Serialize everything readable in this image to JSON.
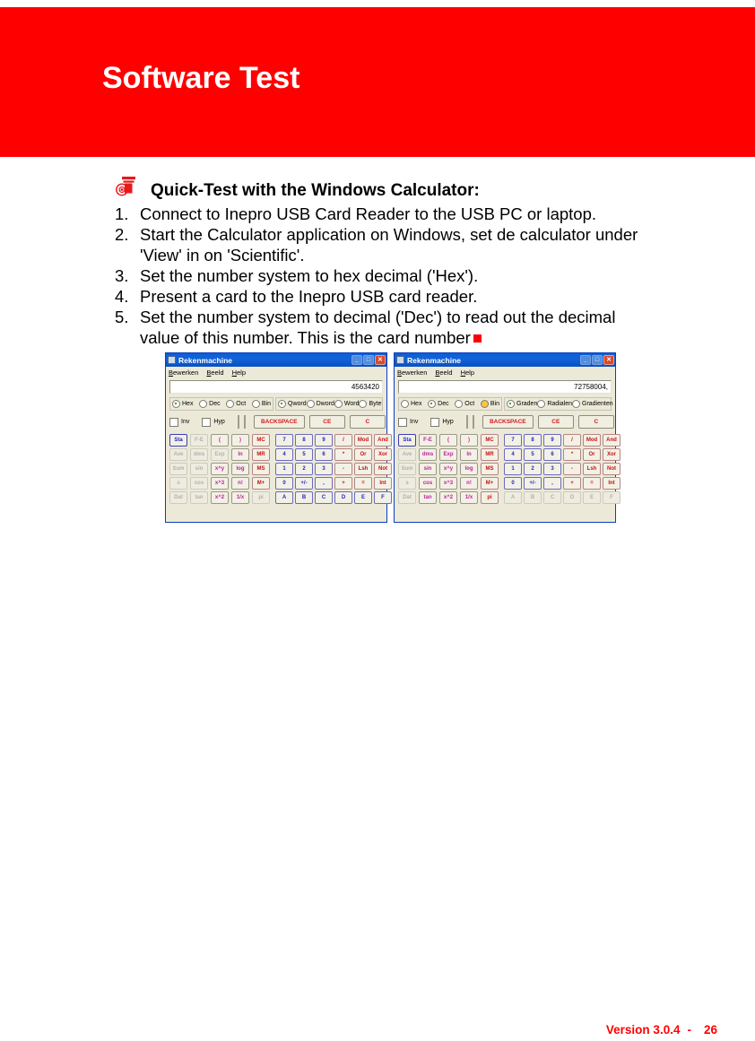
{
  "header": {
    "title": "Software Test",
    "band_color": "#fe0000"
  },
  "instructions": {
    "icon": "card-reader-icon",
    "heading": "Quick-Test with the Windows Calculator:",
    "steps": [
      {
        "num": "1.",
        "text": "Connect to Inepro USB Card Reader to the USB PC or laptop."
      },
      {
        "num": "2.",
        "text": "Start the Calculator application on Windows, set de calculator under 'View' in on 'Scientific'."
      },
      {
        "num": "3.",
        "text": "Set the number system to hex decimal ('Hex')."
      },
      {
        "num": "4.",
        "text": "Present a card to the Inepro USB card reader."
      },
      {
        "num": "5.",
        "text": "Set the number system to decimal ('Dec') to read out the decimal value of this number. This is the card number"
      }
    ],
    "end_marker_color": "#fe0000"
  },
  "calculators": [
    {
      "id": "calc-one",
      "title": "Rekenmachine",
      "menus": [
        "Bewerken",
        "Beeld",
        "Help"
      ],
      "display": "4563420",
      "base_radios": [
        {
          "label": "Hex",
          "selected": true,
          "focus": false
        },
        {
          "label": "Dec",
          "selected": false,
          "focus": false
        },
        {
          "label": "Oct",
          "selected": false,
          "focus": false
        },
        {
          "label": "Bin",
          "selected": false,
          "focus": false
        }
      ],
      "mode_radios": [
        {
          "label": "Qword",
          "selected": true,
          "focus": false
        },
        {
          "label": "Dword",
          "selected": false,
          "focus": false
        },
        {
          "label": "Word",
          "selected": false,
          "focus": false
        },
        {
          "label": "Byte",
          "selected": false,
          "focus": false
        }
      ],
      "checks": [
        {
          "label": "Inv",
          "checked": false
        },
        {
          "label": "Hyp",
          "checked": false
        }
      ],
      "command_buttons": [
        "BACKSPACE",
        "CE",
        "C"
      ],
      "keypad": {
        "col_sta": [
          {
            "label": "Sta",
            "style": "strong"
          },
          {
            "label": "Ave",
            "style": "dim"
          },
          {
            "label": "Sum",
            "style": "dim"
          },
          {
            "label": "s",
            "style": "dim"
          },
          {
            "label": "Dat",
            "style": "dim"
          }
        ],
        "col_fn1": [
          {
            "label": "F-E",
            "style": "dim"
          },
          {
            "label": "dms",
            "style": "dim"
          },
          {
            "label": "sin",
            "style": "dim"
          },
          {
            "label": "cos",
            "style": "dim"
          },
          {
            "label": "tan",
            "style": "dim"
          }
        ],
        "col_fn2": [
          {
            "label": "(",
            "style": "pink"
          },
          {
            "label": "Exp",
            "style": "dim"
          },
          {
            "label": "x^y",
            "style": "pink"
          },
          {
            "label": "x^3",
            "style": "pink"
          },
          {
            "label": "x^2",
            "style": "pink"
          }
        ],
        "col_fn3": [
          {
            "label": ")",
            "style": "pink"
          },
          {
            "label": "ln",
            "style": "pink"
          },
          {
            "label": "log",
            "style": "pink"
          },
          {
            "label": "n!",
            "style": "pink"
          },
          {
            "label": "1/x",
            "style": "pink"
          }
        ],
        "col_mem": [
          {
            "label": "MC",
            "style": "red"
          },
          {
            "label": "MR",
            "style": "red"
          },
          {
            "label": "MS",
            "style": "red"
          },
          {
            "label": "M+",
            "style": "red"
          },
          {
            "label": "pi",
            "style": "dim"
          }
        ],
        "grid": [
          [
            {
              "label": "7",
              "style": "blue"
            },
            {
              "label": "8",
              "style": "blue"
            },
            {
              "label": "9",
              "style": "blue"
            },
            {
              "label": "/",
              "style": "red"
            },
            {
              "label": "Mod",
              "style": "red"
            },
            {
              "label": "And",
              "style": "red"
            }
          ],
          [
            {
              "label": "4",
              "style": "blue"
            },
            {
              "label": "5",
              "style": "blue"
            },
            {
              "label": "6",
              "style": "blue"
            },
            {
              "label": "*",
              "style": "red"
            },
            {
              "label": "Or",
              "style": "red"
            },
            {
              "label": "Xor",
              "style": "red"
            }
          ],
          [
            {
              "label": "1",
              "style": "blue"
            },
            {
              "label": "2",
              "style": "blue"
            },
            {
              "label": "3",
              "style": "blue"
            },
            {
              "label": "-",
              "style": "red"
            },
            {
              "label": "Lsh",
              "style": "red"
            },
            {
              "label": "Not",
              "style": "red"
            }
          ],
          [
            {
              "label": "0",
              "style": "blue"
            },
            {
              "label": "+/-",
              "style": "blue"
            },
            {
              "label": ",",
              "style": "blue"
            },
            {
              "label": "+",
              "style": "red"
            },
            {
              "label": "=",
              "style": "red"
            },
            {
              "label": "Int",
              "style": "red"
            }
          ],
          [
            {
              "label": "A",
              "style": "blue"
            },
            {
              "label": "B",
              "style": "blue"
            },
            {
              "label": "C",
              "style": "blue"
            },
            {
              "label": "D",
              "style": "blue"
            },
            {
              "label": "E",
              "style": "blue"
            },
            {
              "label": "F",
              "style": "blue"
            }
          ]
        ]
      }
    },
    {
      "id": "calc-two",
      "title": "Rekenmachine",
      "menus": [
        "Bewerken",
        "Beeld",
        "Help"
      ],
      "display": "72758004,",
      "base_radios": [
        {
          "label": "Hex",
          "selected": false,
          "focus": false
        },
        {
          "label": "Dec",
          "selected": true,
          "focus": false
        },
        {
          "label": "Oct",
          "selected": false,
          "focus": false
        },
        {
          "label": "Bin",
          "selected": false,
          "focus": true
        }
      ],
      "mode_radios": [
        {
          "label": "Graden",
          "selected": true,
          "focus": false
        },
        {
          "label": "Radialen",
          "selected": false,
          "focus": false
        },
        {
          "label": "Gradienten",
          "selected": false,
          "focus": false
        }
      ],
      "checks": [
        {
          "label": "Inv",
          "checked": false
        },
        {
          "label": "Hyp",
          "checked": false
        }
      ],
      "command_buttons": [
        "BACKSPACE",
        "CE",
        "C"
      ],
      "keypad": {
        "col_sta": [
          {
            "label": "Sta",
            "style": "strong"
          },
          {
            "label": "Ave",
            "style": "dim"
          },
          {
            "label": "Sum",
            "style": "dim"
          },
          {
            "label": "s",
            "style": "dim"
          },
          {
            "label": "Dat",
            "style": "dim"
          }
        ],
        "col_fn1": [
          {
            "label": "F-E",
            "style": "pink"
          },
          {
            "label": "dms",
            "style": "pink"
          },
          {
            "label": "sin",
            "style": "pink"
          },
          {
            "label": "cos",
            "style": "pink"
          },
          {
            "label": "tan",
            "style": "pink"
          }
        ],
        "col_fn2": [
          {
            "label": "(",
            "style": "pink"
          },
          {
            "label": "Exp",
            "style": "pink"
          },
          {
            "label": "x^y",
            "style": "pink"
          },
          {
            "label": "x^3",
            "style": "pink"
          },
          {
            "label": "x^2",
            "style": "pink"
          }
        ],
        "col_fn3": [
          {
            "label": ")",
            "style": "pink"
          },
          {
            "label": "ln",
            "style": "pink"
          },
          {
            "label": "log",
            "style": "pink"
          },
          {
            "label": "n!",
            "style": "pink"
          },
          {
            "label": "1/x",
            "style": "pink"
          }
        ],
        "col_mem": [
          {
            "label": "MC",
            "style": "red"
          },
          {
            "label": "MR",
            "style": "red"
          },
          {
            "label": "MS",
            "style": "red"
          },
          {
            "label": "M+",
            "style": "red"
          },
          {
            "label": "pi",
            "style": "red"
          }
        ],
        "grid": [
          [
            {
              "label": "7",
              "style": "blue"
            },
            {
              "label": "8",
              "style": "blue"
            },
            {
              "label": "9",
              "style": "blue"
            },
            {
              "label": "/",
              "style": "red"
            },
            {
              "label": "Mod",
              "style": "red"
            },
            {
              "label": "And",
              "style": "red"
            }
          ],
          [
            {
              "label": "4",
              "style": "blue"
            },
            {
              "label": "5",
              "style": "blue"
            },
            {
              "label": "6",
              "style": "blue"
            },
            {
              "label": "*",
              "style": "red"
            },
            {
              "label": "Or",
              "style": "red"
            },
            {
              "label": "Xor",
              "style": "red"
            }
          ],
          [
            {
              "label": "1",
              "style": "blue"
            },
            {
              "label": "2",
              "style": "blue"
            },
            {
              "label": "3",
              "style": "blue"
            },
            {
              "label": "-",
              "style": "red"
            },
            {
              "label": "Lsh",
              "style": "red"
            },
            {
              "label": "Not",
              "style": "red"
            }
          ],
          [
            {
              "label": "0",
              "style": "blue"
            },
            {
              "label": "+/-",
              "style": "blue"
            },
            {
              "label": ",",
              "style": "blue"
            },
            {
              "label": "+",
              "style": "red"
            },
            {
              "label": "=",
              "style": "red"
            },
            {
              "label": "Int",
              "style": "red"
            }
          ],
          [
            {
              "label": "A",
              "style": "dim"
            },
            {
              "label": "B",
              "style": "dim"
            },
            {
              "label": "C",
              "style": "dim"
            },
            {
              "label": "D",
              "style": "dim"
            },
            {
              "label": "E",
              "style": "dim"
            },
            {
              "label": "F",
              "style": "dim"
            }
          ]
        ]
      }
    }
  ],
  "footer": {
    "version": "Version 3.0.4",
    "separator": "-",
    "page": "26",
    "color": "#fe0000"
  }
}
